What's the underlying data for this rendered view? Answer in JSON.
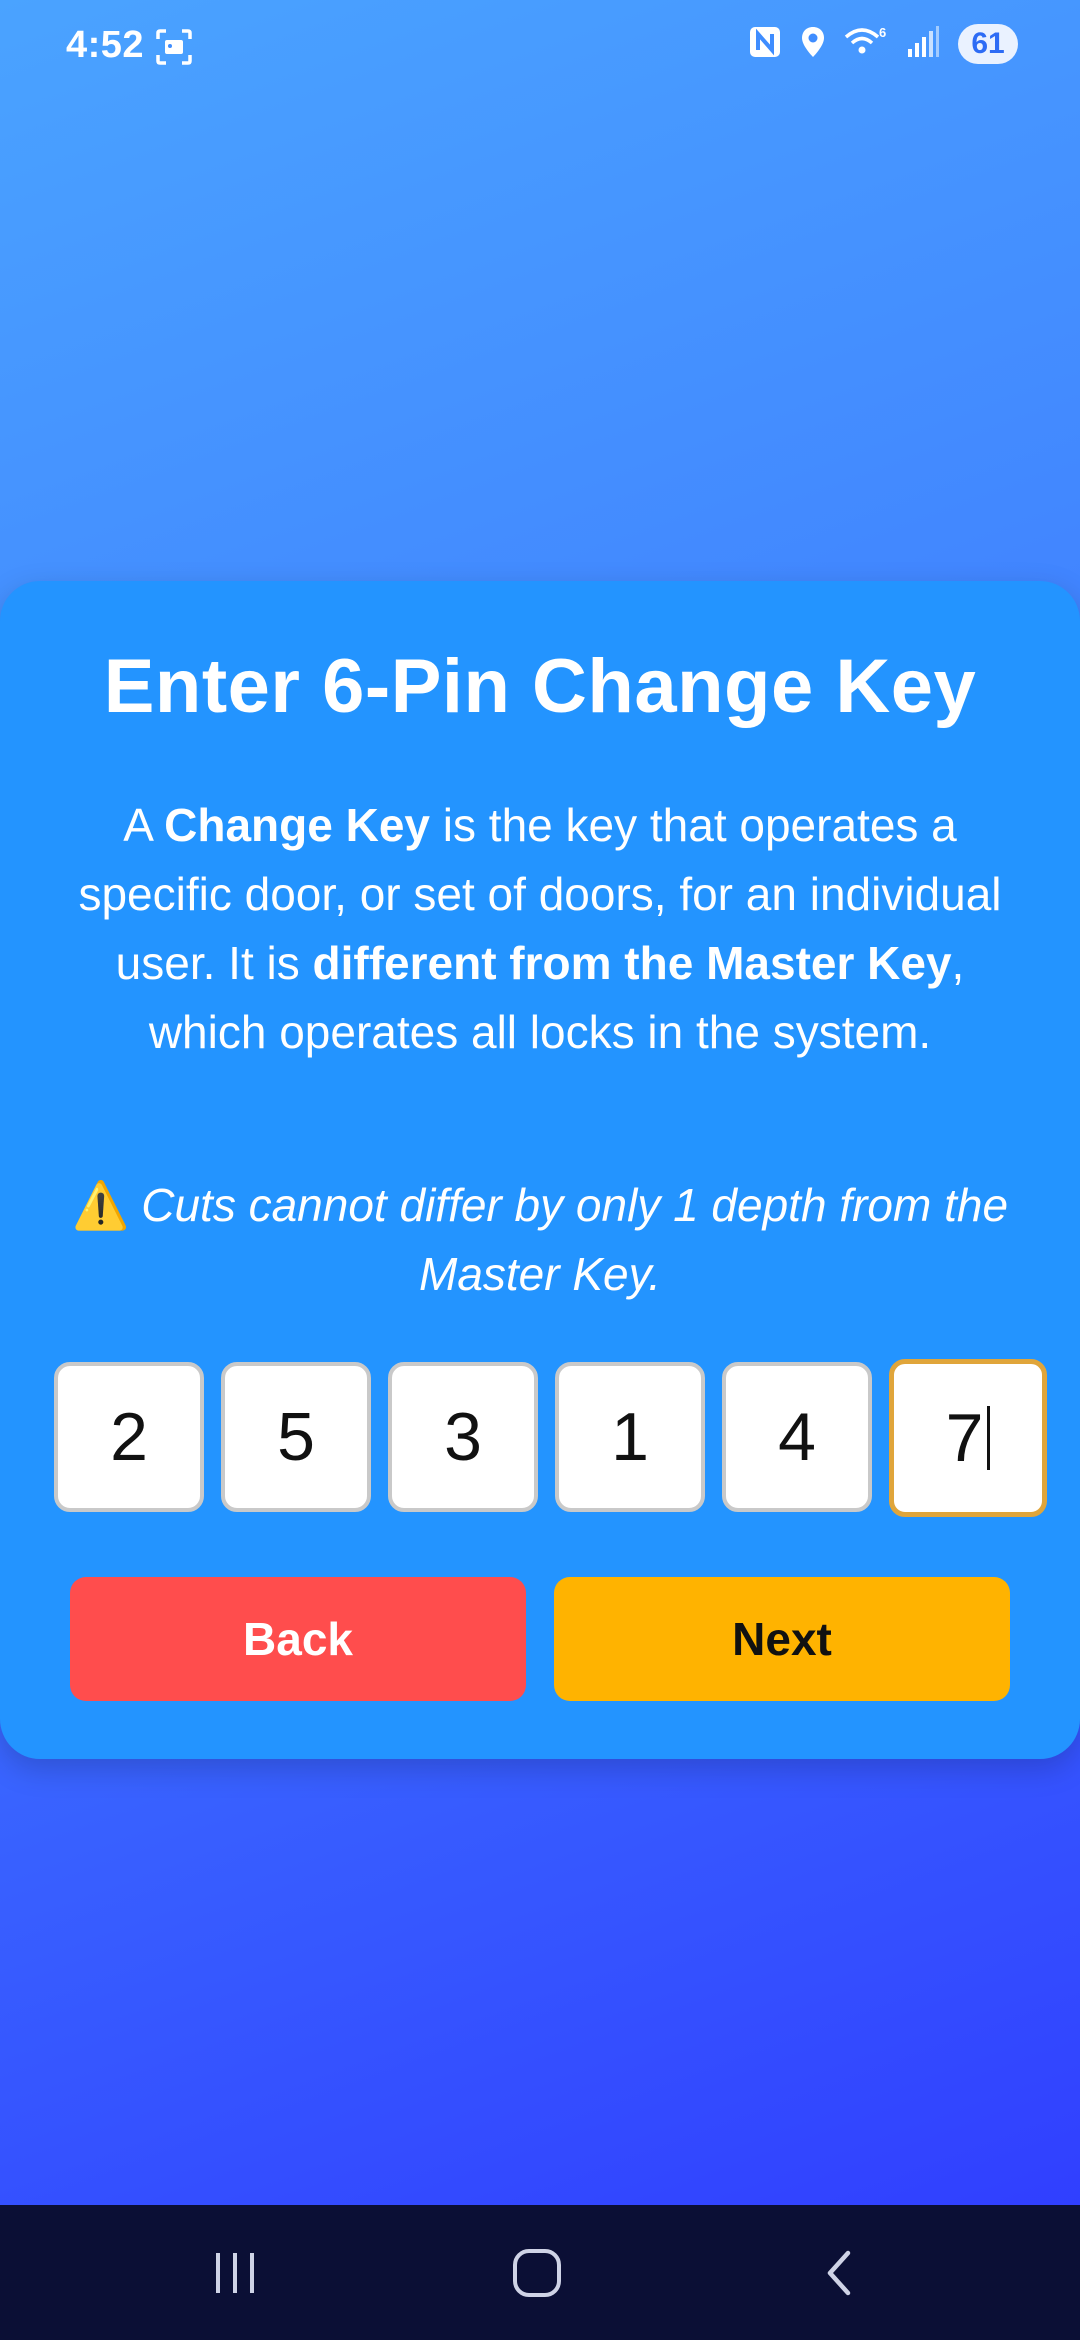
{
  "status_bar": {
    "time": "4:52",
    "left_icon": "screenshot-icon",
    "right_icons": [
      "nfc-icon",
      "location-icon",
      "wifi-6-icon",
      "signal-icon"
    ],
    "battery": "61"
  },
  "card": {
    "title": "Enter 6-Pin Change Key",
    "description": {
      "p1": "A ",
      "b1": "Change Key",
      "p2": " is the key that operates a specific door, or set of doors, for an individual user. It is ",
      "b2": "different from the Master Key",
      "p3": ", which operates all locks in the system."
    },
    "warning": {
      "icon": "⚠️",
      "text": "Cuts cannot differ by only 1 depth from the Master Key."
    },
    "pins": [
      "2",
      "5",
      "3",
      "1",
      "4",
      "7"
    ],
    "active_pin_index": 5,
    "back_label": "Back",
    "next_label": "Next"
  },
  "colors": {
    "card": "#2394ff",
    "back_button": "#ff4d4d",
    "next_button": "#ffb300",
    "active_pin_border": "#e0a53a",
    "nav_bar": "#0b0f35"
  },
  "nav_bar": {
    "icons": [
      "recent-apps-icon",
      "home-icon",
      "back-nav-icon"
    ]
  }
}
